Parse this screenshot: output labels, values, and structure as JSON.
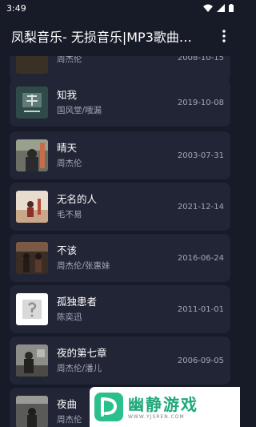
{
  "status_bar": {
    "time": "3:49"
  },
  "app_bar": {
    "title": "凤梨音乐- 无损音乐|MP3歌曲…"
  },
  "songs": [
    {
      "title": "",
      "artist": "周杰伦",
      "date": "2008-10-15"
    },
    {
      "title": "知我",
      "artist": "国风堂/哦漏",
      "date": "2019-10-08"
    },
    {
      "title": "晴天",
      "artist": "周杰伦",
      "date": "2003-07-31"
    },
    {
      "title": "无名的人",
      "artist": "毛不易",
      "date": "2021-12-14"
    },
    {
      "title": "不该",
      "artist": "周杰伦/张惠妹",
      "date": "2016-06-24"
    },
    {
      "title": "孤独患者",
      "artist": "陈奕迅",
      "date": "2011-01-01"
    },
    {
      "title": "夜的第七章",
      "artist": "周杰伦/潘儿",
      "date": "2006-09-05"
    },
    {
      "title": "夜曲",
      "artist": "周杰伦",
      "date": ""
    }
  ],
  "watermark": {
    "name": "幽静游戏",
    "url": "WWW.YJSREN.COM"
  },
  "colors": {
    "background": "#171a27",
    "card": "#212535",
    "secondary_text": "#a3a7b6",
    "brand_green": "#1fa87a"
  }
}
